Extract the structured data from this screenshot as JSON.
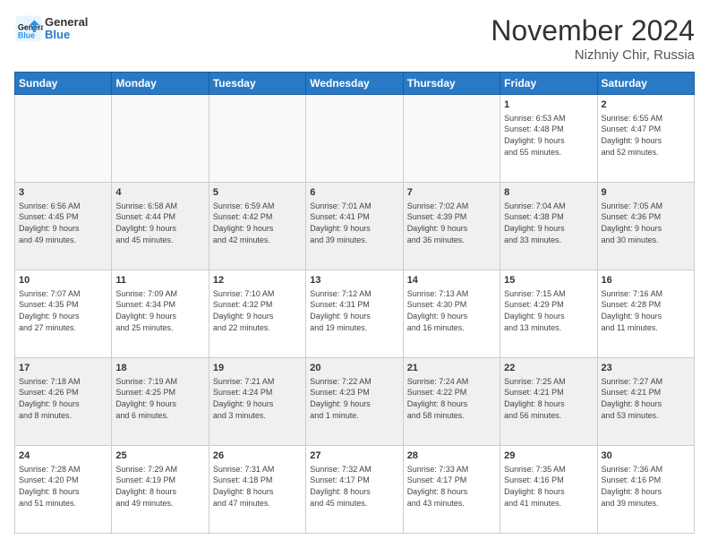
{
  "header": {
    "logo_line1": "General",
    "logo_line2": "Blue",
    "month_title": "November 2024",
    "subtitle": "Nizhniy Chir, Russia"
  },
  "weekdays": [
    "Sunday",
    "Monday",
    "Tuesday",
    "Wednesday",
    "Thursday",
    "Friday",
    "Saturday"
  ],
  "weeks": [
    [
      {
        "day": "",
        "info": ""
      },
      {
        "day": "",
        "info": ""
      },
      {
        "day": "",
        "info": ""
      },
      {
        "day": "",
        "info": ""
      },
      {
        "day": "",
        "info": ""
      },
      {
        "day": "1",
        "info": "Sunrise: 6:53 AM\nSunset: 4:48 PM\nDaylight: 9 hours\nand 55 minutes."
      },
      {
        "day": "2",
        "info": "Sunrise: 6:55 AM\nSunset: 4:47 PM\nDaylight: 9 hours\nand 52 minutes."
      }
    ],
    [
      {
        "day": "3",
        "info": "Sunrise: 6:56 AM\nSunset: 4:45 PM\nDaylight: 9 hours\nand 49 minutes."
      },
      {
        "day": "4",
        "info": "Sunrise: 6:58 AM\nSunset: 4:44 PM\nDaylight: 9 hours\nand 45 minutes."
      },
      {
        "day": "5",
        "info": "Sunrise: 6:59 AM\nSunset: 4:42 PM\nDaylight: 9 hours\nand 42 minutes."
      },
      {
        "day": "6",
        "info": "Sunrise: 7:01 AM\nSunset: 4:41 PM\nDaylight: 9 hours\nand 39 minutes."
      },
      {
        "day": "7",
        "info": "Sunrise: 7:02 AM\nSunset: 4:39 PM\nDaylight: 9 hours\nand 36 minutes."
      },
      {
        "day": "8",
        "info": "Sunrise: 7:04 AM\nSunset: 4:38 PM\nDaylight: 9 hours\nand 33 minutes."
      },
      {
        "day": "9",
        "info": "Sunrise: 7:05 AM\nSunset: 4:36 PM\nDaylight: 9 hours\nand 30 minutes."
      }
    ],
    [
      {
        "day": "10",
        "info": "Sunrise: 7:07 AM\nSunset: 4:35 PM\nDaylight: 9 hours\nand 27 minutes."
      },
      {
        "day": "11",
        "info": "Sunrise: 7:09 AM\nSunset: 4:34 PM\nDaylight: 9 hours\nand 25 minutes."
      },
      {
        "day": "12",
        "info": "Sunrise: 7:10 AM\nSunset: 4:32 PM\nDaylight: 9 hours\nand 22 minutes."
      },
      {
        "day": "13",
        "info": "Sunrise: 7:12 AM\nSunset: 4:31 PM\nDaylight: 9 hours\nand 19 minutes."
      },
      {
        "day": "14",
        "info": "Sunrise: 7:13 AM\nSunset: 4:30 PM\nDaylight: 9 hours\nand 16 minutes."
      },
      {
        "day": "15",
        "info": "Sunrise: 7:15 AM\nSunset: 4:29 PM\nDaylight: 9 hours\nand 13 minutes."
      },
      {
        "day": "16",
        "info": "Sunrise: 7:16 AM\nSunset: 4:28 PM\nDaylight: 9 hours\nand 11 minutes."
      }
    ],
    [
      {
        "day": "17",
        "info": "Sunrise: 7:18 AM\nSunset: 4:26 PM\nDaylight: 9 hours\nand 8 minutes."
      },
      {
        "day": "18",
        "info": "Sunrise: 7:19 AM\nSunset: 4:25 PM\nDaylight: 9 hours\nand 6 minutes."
      },
      {
        "day": "19",
        "info": "Sunrise: 7:21 AM\nSunset: 4:24 PM\nDaylight: 9 hours\nand 3 minutes."
      },
      {
        "day": "20",
        "info": "Sunrise: 7:22 AM\nSunset: 4:23 PM\nDaylight: 9 hours\nand 1 minute."
      },
      {
        "day": "21",
        "info": "Sunrise: 7:24 AM\nSunset: 4:22 PM\nDaylight: 8 hours\nand 58 minutes."
      },
      {
        "day": "22",
        "info": "Sunrise: 7:25 AM\nSunset: 4:21 PM\nDaylight: 8 hours\nand 56 minutes."
      },
      {
        "day": "23",
        "info": "Sunrise: 7:27 AM\nSunset: 4:21 PM\nDaylight: 8 hours\nand 53 minutes."
      }
    ],
    [
      {
        "day": "24",
        "info": "Sunrise: 7:28 AM\nSunset: 4:20 PM\nDaylight: 8 hours\nand 51 minutes."
      },
      {
        "day": "25",
        "info": "Sunrise: 7:29 AM\nSunset: 4:19 PM\nDaylight: 8 hours\nand 49 minutes."
      },
      {
        "day": "26",
        "info": "Sunrise: 7:31 AM\nSunset: 4:18 PM\nDaylight: 8 hours\nand 47 minutes."
      },
      {
        "day": "27",
        "info": "Sunrise: 7:32 AM\nSunset: 4:17 PM\nDaylight: 8 hours\nand 45 minutes."
      },
      {
        "day": "28",
        "info": "Sunrise: 7:33 AM\nSunset: 4:17 PM\nDaylight: 8 hours\nand 43 minutes."
      },
      {
        "day": "29",
        "info": "Sunrise: 7:35 AM\nSunset: 4:16 PM\nDaylight: 8 hours\nand 41 minutes."
      },
      {
        "day": "30",
        "info": "Sunrise: 7:36 AM\nSunset: 4:16 PM\nDaylight: 8 hours\nand 39 minutes."
      }
    ]
  ]
}
